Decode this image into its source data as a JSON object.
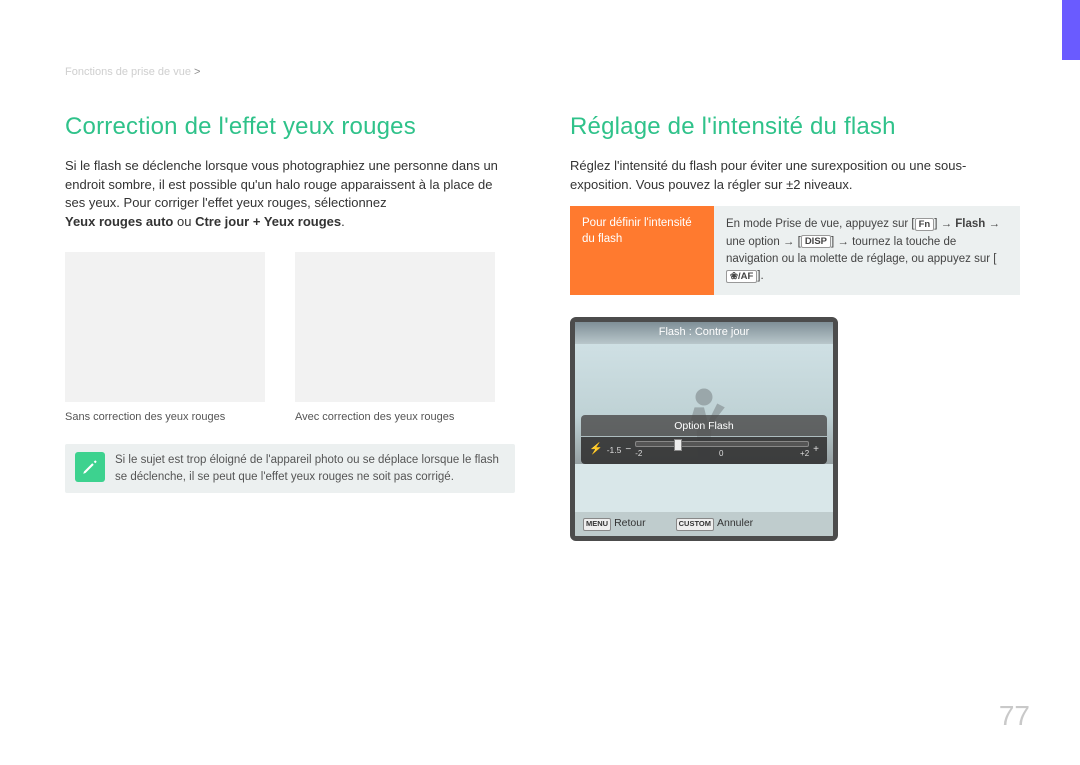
{
  "breadcrumb": {
    "section": "Fonctions de prise de vue",
    "sep": ">"
  },
  "left": {
    "heading": "Correction de l'effet yeux rouges",
    "p1": "Si le flash se déclenche lorsque vous photographiez une personne dans un endroit sombre, il est possible qu'un halo rouge apparaissent à la place de ses yeux. Pour corriger l'effet yeux rouges, sélectionnez ",
    "opt1": "Yeux rouges auto",
    "or": " ou ",
    "opt2": "Ctre jour + Yeux rouges",
    "dot": ".",
    "cap1": "Sans correction des yeux rouges",
    "cap2": "Avec correction des yeux rouges",
    "note": "Si le sujet est trop éloigné de l'appareil photo ou se déplace lorsque le flash se déclenche, il se peut que l'effet yeux rouges ne soit pas corrigé."
  },
  "right": {
    "heading": "Réglage de l'intensité du flash",
    "p1": "Réglez l'intensité du flash pour éviter une surexposition ou une sous-exposition. Vous pouvez la régler sur ±2 niveaux.",
    "def_label": "Pour définir l'intensité du flash",
    "def_pre": "En mode Prise de vue, appuyez sur [",
    "fn": "Fn",
    "def_mid1": "] → ",
    "flash_word": "Flash",
    "def_mid2": " → une option → [",
    "disp": "DISP",
    "def_mid3": "] → tournez la touche de navigation ou la molette de réglage, ou appuyez sur [",
    "iaf": "❀/AF",
    "def_end": "].",
    "camera": {
      "title": "Flash : Contre jour",
      "option_label": "Option Flash",
      "current_value": "-1.5",
      "scale_min": "-2",
      "scale_mid": "0",
      "scale_max": "+2",
      "btn_menu": "MENU",
      "lbl_menu": "Retour",
      "btn_custom": "CUSTOM",
      "lbl_custom": "Annuler"
    }
  },
  "page_number": "77",
  "icons": {
    "minus": "−",
    "plus": "+",
    "bolt": "⚡",
    "arrow": "→"
  }
}
